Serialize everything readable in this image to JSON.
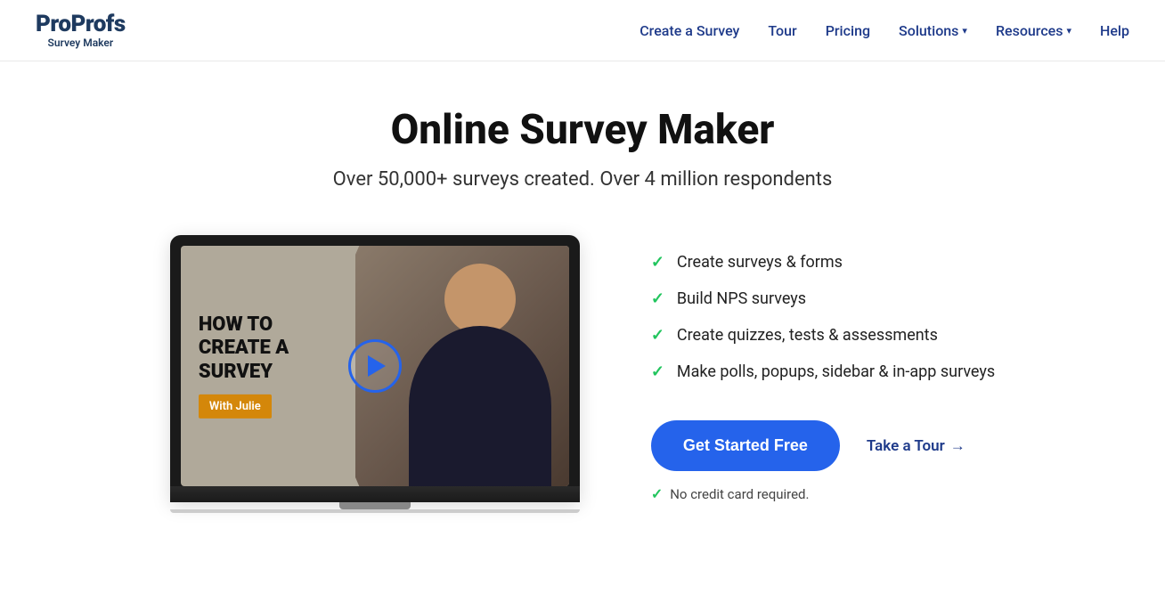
{
  "header": {
    "logo_pro": "Pro",
    "logo_profs": "Profs",
    "logo_sub": "Survey Maker",
    "nav": {
      "create_survey": "Create a Survey",
      "tour": "Tour",
      "pricing": "Pricing",
      "solutions": "Solutions",
      "resources": "Resources",
      "help": "Help"
    }
  },
  "hero": {
    "title": "Online Survey Maker",
    "subtitle": "Over 50,000+ surveys created. Over 4 million respondents",
    "video": {
      "title_line1": "HOW TO",
      "title_line2": "CREATE A",
      "title_line3": "SURVEY",
      "badge": "With Julie"
    },
    "features": [
      "Create surveys & forms",
      "Build NPS surveys",
      "Create quizzes, tests & assessments",
      "Make polls, popups, sidebar & in-app surveys"
    ],
    "cta_primary": "Get Started Free",
    "cta_tour": "Take a Tour",
    "cta_tour_arrow": "→",
    "no_credit": "No credit card required."
  },
  "colors": {
    "primary_blue": "#2563eb",
    "dark_navy": "#1e3a8a",
    "green_check": "#22c55e",
    "badge_orange": "#d4870a"
  }
}
